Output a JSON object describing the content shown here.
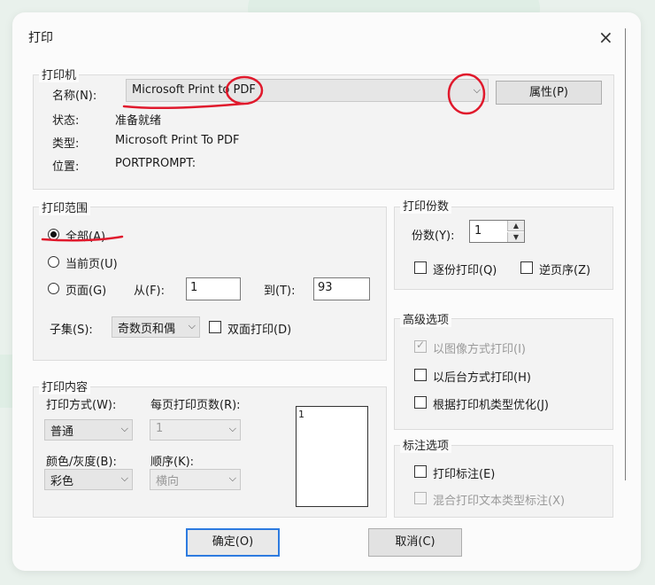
{
  "window": {
    "title": "打印",
    "close_glyph": "×"
  },
  "printer": {
    "legend": "打印机",
    "name_label": "名称(N):",
    "name_value": "Microsoft Print to PDF",
    "properties_button": "属性(P)",
    "status_label": "状态:",
    "status_value": "准备就绪",
    "type_label": "类型:",
    "type_value": "Microsoft Print To PDF",
    "location_label": "位置:",
    "location_value": "PORTPROMPT:"
  },
  "range": {
    "legend": "打印范围",
    "all_label": "全部(A)",
    "current_label": "当前页(U)",
    "pages_label": "页面(G)",
    "from_label": "从(F):",
    "from_value": "1",
    "to_label": "到(T):",
    "to_value": "93",
    "subset_label": "子集(S):",
    "subset_value": "奇数页和偶",
    "duplex_label": "双面打印(D)"
  },
  "copies": {
    "legend": "打印份数",
    "copies_label": "份数(Y):",
    "copies_value": "1",
    "collate_label": "逐份打印(Q)",
    "reverse_label": "逆页序(Z)"
  },
  "advanced": {
    "legend": "高级选项",
    "print_as_image": "以图像方式打印(I)",
    "background_print": "以后台方式打印(H)",
    "optimize_by_type": "根据打印机类型优化(J)"
  },
  "annotation": {
    "legend": "标注选项",
    "print_annotation": "打印标注(E)",
    "mixed_annotation": "混合打印文本类型标注(X)"
  },
  "content": {
    "legend": "打印内容",
    "mode_label": "打印方式(W):",
    "mode_value": "普通",
    "pages_per_sheet_label": "每页打印页数(R):",
    "pages_per_sheet_value": "1",
    "color_label": "颜色/灰度(B):",
    "color_value": "彩色",
    "order_label": "顺序(K):",
    "order_value": "横向",
    "preview_value": "1"
  },
  "footer": {
    "ok": "确定(O)",
    "cancel": "取消(C)"
  },
  "colors": {
    "annotation_red": "#e0192c",
    "focus_blue": "#2d7be0"
  }
}
